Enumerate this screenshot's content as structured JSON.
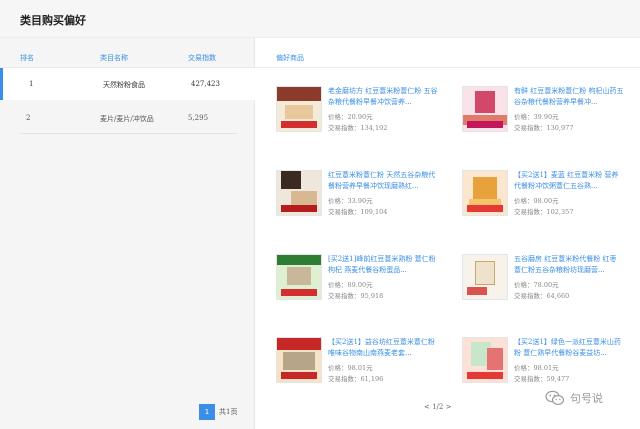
{
  "page": {
    "title": "类目购买偏好"
  },
  "table": {
    "headers": {
      "rank": "排名",
      "name": "类目名称",
      "index": "交易指数",
      "preferred": "偏好商品"
    },
    "rows": [
      {
        "rank": "1",
        "name": "天然粉粉食品",
        "index": "427,423",
        "active": true
      },
      {
        "rank": "2",
        "name": "麦片/麦片/冲饮品",
        "index": "5,295",
        "active": false
      }
    ]
  },
  "pager_left": {
    "current": "1",
    "total": "共1页"
  },
  "products": [
    {
      "title": "老金磨坊方 红豆薏米粉薏仁粉 五谷杂粮代餐粉早餐冲饮营养...",
      "price": "价格：20.90元",
      "volume": "交易指数：134,192"
    },
    {
      "title": "有鲜 红豆薏米粉薏仁粉 枸杞山药五谷杂粮代餐粉营养早餐冲...",
      "price": "价格：39.90元",
      "volume": "交易指数：130,977"
    },
    {
      "title": "红豆薏米粉薏仁粉 天然五谷杂粮代餐粉营养早餐冲饮现磨熟红...",
      "price": "价格：33.90元",
      "volume": "交易指数：109,104"
    },
    {
      "title": "【买2送1】麦蓝 红豆薏米粉 营养代餐粉冲饮粥薏仁五谷熟...",
      "price": "价格：98.00元",
      "volume": "交易指数：102,357"
    },
    {
      "title": "[买2送1]峰前红豆薏米熟粉 薏仁粉 枸杞 燕麦代餐谷粉蛋品...",
      "price": "价格：89.00元",
      "volume": "交易指数：95,918"
    },
    {
      "title": "五谷磨房 红豆薏米粉代餐粉 红枣 薏仁粉五谷杂粮粉坊现磨营...",
      "price": "价格：78.00元",
      "volume": "交易指数：64,660"
    },
    {
      "title": "【买2送1】益谷坊红豆薏米薏仁粉 唯味谷物南山南燕麦老套...",
      "price": "价格：98.01元",
      "volume": "交易指数：61,196"
    },
    {
      "title": "【买2送1】绿色一派红豆薏米山药粉 薏仁熟早代餐粉谷麦益坊...",
      "price": "价格：98.01元",
      "volume": "交易指数：59,477"
    }
  ],
  "pager_right": {
    "text": "< 1/2 >"
  },
  "watermark": {
    "text": "句号说",
    "icon": "wechat-icon"
  },
  "colors": {
    "accent": "#3a8ee6",
    "panel": "#f5f5f5",
    "badge_red": "#d32f2f"
  }
}
